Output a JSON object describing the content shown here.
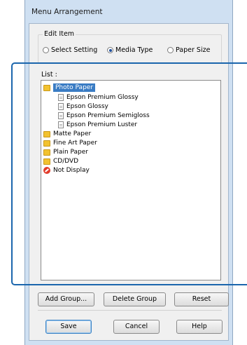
{
  "window": {
    "title": "Menu Arrangement"
  },
  "edit_item": {
    "label": "Edit Item",
    "options": [
      {
        "label": "Select Setting",
        "checked": false
      },
      {
        "label": "Media Type",
        "checked": true
      },
      {
        "label": "Paper Size",
        "checked": false
      }
    ]
  },
  "list": {
    "label": "List :",
    "items": [
      {
        "label": "Photo Paper",
        "icon": "folder-icon",
        "selected": true
      },
      {
        "label": "Epson Premium Glossy",
        "icon": "document-cursor-icon"
      },
      {
        "label": "Epson Glossy",
        "icon": "document-icon"
      },
      {
        "label": "Epson Premium Semigloss",
        "icon": "document-icon"
      },
      {
        "label": "Epson Premium Luster",
        "icon": "document-icon"
      },
      {
        "label": "Matte Paper",
        "icon": "folder-icon"
      },
      {
        "label": "Fine Art Paper",
        "icon": "folder-icon"
      },
      {
        "label": "Plain Paper",
        "icon": "folder-icon"
      },
      {
        "label": "CD/DVD",
        "icon": "folder-icon"
      },
      {
        "label": "Not Display",
        "icon": "no-entry-icon"
      }
    ]
  },
  "buttons": {
    "add_group": "Add Group...",
    "delete_group": "Delete Group",
    "reset": "Reset",
    "save": "Save",
    "cancel": "Cancel",
    "help": "Help"
  },
  "colors": {
    "window_frame": "#cfe0f2",
    "selection": "#3a7cc4",
    "callout": "#1b66ad"
  }
}
